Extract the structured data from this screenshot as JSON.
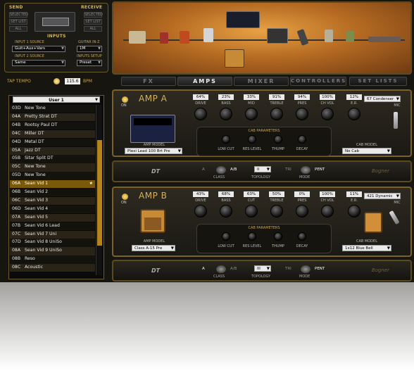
{
  "routing": {
    "send_label": "SEND",
    "receive_label": "RECEIVE",
    "send_buttons": [
      "SELECTED",
      "SET LIST",
      "ALL"
    ],
    "receive_buttons": [
      "SELECTED",
      "SET LIST",
      "ALL"
    ],
    "inputs_label": "INPUTS",
    "input1_label": "INPUT 1 SOURCE",
    "input1_value": "Guit+Aux+Vars",
    "guitar_in_label": "GUITAR IN-Z",
    "guitar_in_value": "1M",
    "input2_label": "INPUT 2 SOURCE",
    "input2_value": "Same",
    "inputs_setup_label": "INPUTS SETUP",
    "inputs_setup_value": "Preset"
  },
  "tempo": {
    "label": "TAP TEMPO",
    "value": "115.6",
    "unit": "BPM"
  },
  "tabs": [
    "FX",
    "AMPS",
    "MIXER",
    "CONTROLLERS",
    "SET LISTS"
  ],
  "active_tab": "AMPS",
  "presets": {
    "bank": "User 1",
    "items": [
      {
        "num": "03D",
        "name": "New Tone"
      },
      {
        "num": "04A",
        "name": "Pretty Strat DT"
      },
      {
        "num": "04B",
        "name": "Rootsy Paul DT"
      },
      {
        "num": "04C",
        "name": "Miller DT"
      },
      {
        "num": "04D",
        "name": "Metal DT"
      },
      {
        "num": "05A",
        "name": "Jazz DT"
      },
      {
        "num": "05B",
        "name": "Sitar Split DT"
      },
      {
        "num": "05C",
        "name": "New Tone"
      },
      {
        "num": "05D",
        "name": "New Tone"
      },
      {
        "num": "06A",
        "name": "Sean Vid 1"
      },
      {
        "num": "06B",
        "name": "Sean Vid 2"
      },
      {
        "num": "06C",
        "name": "Sean Vid 3"
      },
      {
        "num": "06D",
        "name": "Sean Vid 4"
      },
      {
        "num": "07A",
        "name": "Sean Vid 5"
      },
      {
        "num": "07B",
        "name": "Sean Vid 6 Lead"
      },
      {
        "num": "07C",
        "name": "Sean Vid 7 Uni"
      },
      {
        "num": "07D",
        "name": "Sean Vid 8 UniSo"
      },
      {
        "num": "08A",
        "name": "Sean Vid 9 UniSo"
      },
      {
        "num": "08B",
        "name": "Reso"
      },
      {
        "num": "08C",
        "name": "Acoustic"
      }
    ],
    "selected_index": 9
  },
  "amp_a": {
    "title": "AMP A",
    "on_label": "ON",
    "knobs": [
      {
        "label": "DRIVE",
        "value": "64%"
      },
      {
        "label": "BASS",
        "value": "23%"
      },
      {
        "label": "MID",
        "value": "33%"
      },
      {
        "label": "TREBLE",
        "value": "91%"
      },
      {
        "label": "PRES",
        "value": "94%"
      },
      {
        "label": "CH VOL",
        "value": "100%"
      },
      {
        "label": "E.R.",
        "value": "12%"
      }
    ],
    "mic_value": "67 Condenser",
    "mic_label": "MIC",
    "cab_params_label": "CAB PARAMETERS",
    "cab_knobs": [
      "LOW CUT",
      "RES LEVEL",
      "THUMP",
      "DECAY"
    ],
    "amp_model_label": "AMP MODEL",
    "amp_model_value": "Plexi Lead 100 Brt Pre",
    "cab_model_label": "CAB MODEL",
    "cab_model_value": "No Cab"
  },
  "amp_b": {
    "title": "AMP B",
    "on_label": "ON",
    "knobs": [
      {
        "label": "DRIVE",
        "value": "43%"
      },
      {
        "label": "BASS",
        "value": "68%"
      },
      {
        "label": "CUT",
        "value": "63%"
      },
      {
        "label": "TREBLE",
        "value": "50%"
      },
      {
        "label": "PRES",
        "value": "0%"
      },
      {
        "label": "CH VOL",
        "value": "100%"
      },
      {
        "label": "E.R.",
        "value": "11%"
      }
    ],
    "mic_value": "421 Dynamic",
    "mic_label": "MIC",
    "cab_params_label": "CAB PARAMETERS",
    "cab_knobs": [
      "LOW CUT",
      "RES LEVEL",
      "THUMP",
      "DECAY"
    ],
    "amp_model_label": "AMP MODEL",
    "amp_model_value": "Class A-15 Pre",
    "cab_model_label": "CAB MODEL",
    "cab_model_value": "1x12 Blue Bell"
  },
  "dt_a": {
    "label": "DT",
    "class_a": "A",
    "class_ab": "A/B",
    "class_label": "CLASS",
    "topology_value": "II",
    "topology_label": "TOPOLOGY",
    "mode_tri": "TRI",
    "mode_pent": "PENT",
    "mode_label": "MODE",
    "brand": "Bogner"
  },
  "dt_b": {
    "label": "DT",
    "class_a": "A",
    "class_ab": "A/B",
    "class_label": "CLASS",
    "topology_value": "III",
    "topology_label": "TOPOLOGY",
    "mode_tri": "TRI",
    "mode_pent": "PENT",
    "mode_label": "MODE",
    "brand": "Bogner"
  },
  "colors": {
    "accent": "#d6b254",
    "selected_row": "#7a5a0a",
    "panel_border": "#7a6226"
  }
}
